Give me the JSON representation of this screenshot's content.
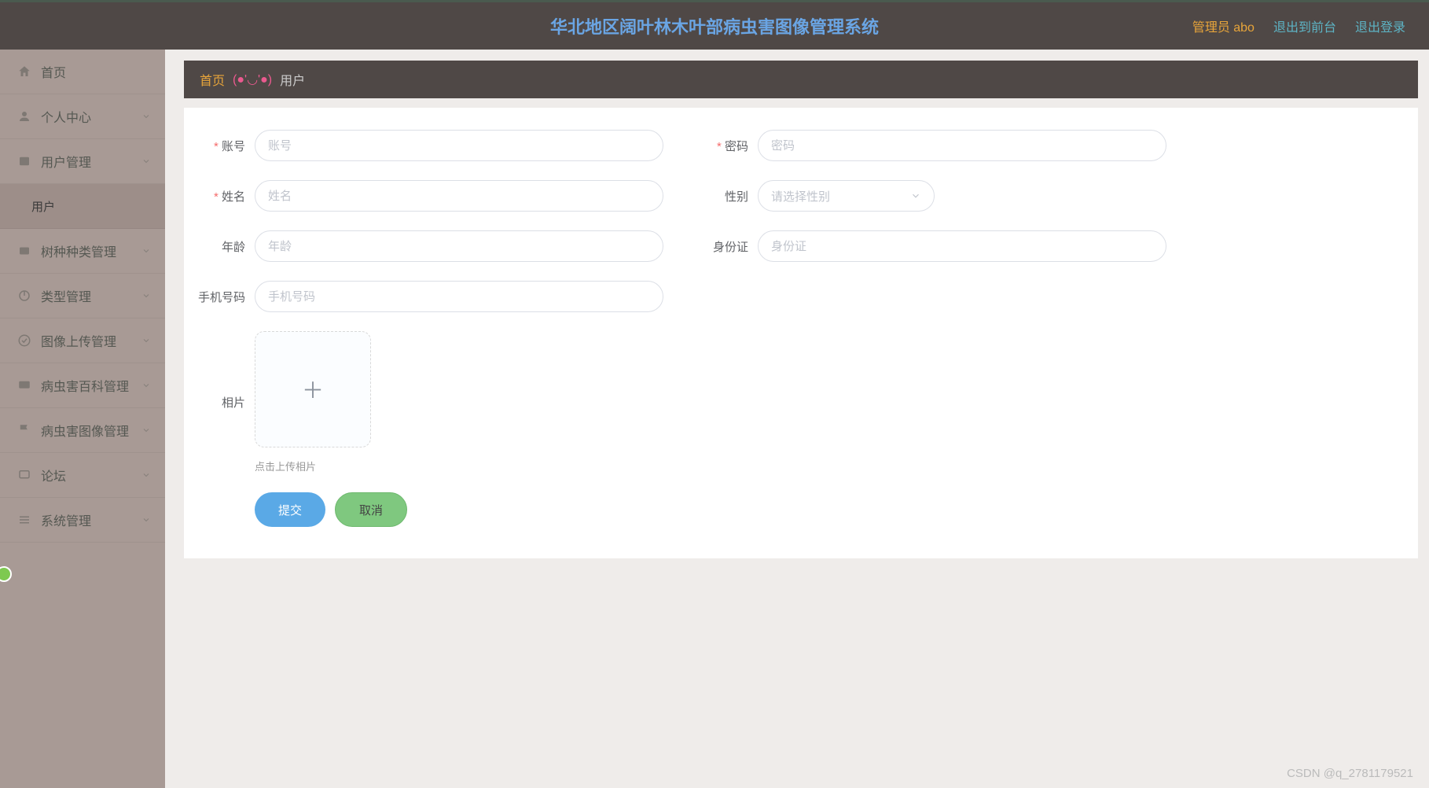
{
  "header": {
    "title": "华北地区阔叶林木叶部病虫害图像管理系统",
    "admin_label": "管理员 abo",
    "exit_front": "退出到前台",
    "logout": "退出登录"
  },
  "sidebar": {
    "items": [
      {
        "label": "首页",
        "icon": "home"
      },
      {
        "label": "个人中心",
        "icon": "user",
        "expandable": true
      },
      {
        "label": "用户管理",
        "icon": "users",
        "expandable": true
      },
      {
        "label": "用户",
        "sub": true
      },
      {
        "label": "树种种类管理",
        "icon": "tree",
        "expandable": true
      },
      {
        "label": "类型管理",
        "icon": "power",
        "expandable": true
      },
      {
        "label": "图像上传管理",
        "icon": "check",
        "expandable": true
      },
      {
        "label": "病虫害百科管理",
        "icon": "monitor",
        "expandable": true
      },
      {
        "label": "病虫害图像管理",
        "icon": "flag",
        "expandable": true
      },
      {
        "label": "论坛",
        "icon": "chat",
        "expandable": true
      },
      {
        "label": "系统管理",
        "icon": "menu",
        "expandable": true
      }
    ]
  },
  "breadcrumb": {
    "home": "首页",
    "face": "(●'◡'●)",
    "current": "用户"
  },
  "form": {
    "account": {
      "label": "账号",
      "placeholder": "账号"
    },
    "password": {
      "label": "密码",
      "placeholder": "密码"
    },
    "name": {
      "label": "姓名",
      "placeholder": "姓名"
    },
    "gender": {
      "label": "性别",
      "placeholder": "请选择性别"
    },
    "age": {
      "label": "年龄",
      "placeholder": "年龄"
    },
    "idcard": {
      "label": "身份证",
      "placeholder": "身份证"
    },
    "phone": {
      "label": "手机号码",
      "placeholder": "手机号码"
    },
    "photo": {
      "label": "相片",
      "hint": "点击上传相片"
    },
    "submit": "提交",
    "cancel": "取消"
  },
  "watermark": "CSDN @q_2781179521"
}
